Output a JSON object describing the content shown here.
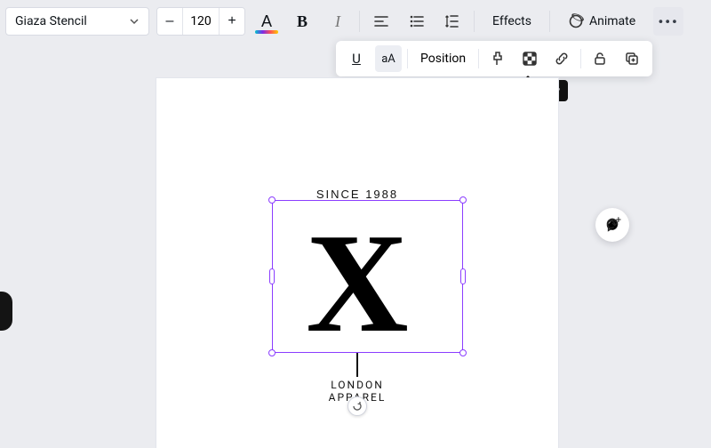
{
  "toolbar": {
    "font_name": "Giaza Stencil",
    "font_size": "120",
    "decrease": "–",
    "increase": "+",
    "color_label": "A",
    "bold": "B",
    "italic": "I",
    "effects": "Effects",
    "animate": "Animate",
    "more": "•••"
  },
  "popover": {
    "underline": "U",
    "case": "aA",
    "position": "Position",
    "tooltip": "Transparency"
  },
  "canvas": {
    "since": "SINCE 1988",
    "big_letter": "X",
    "city": "LONDON",
    "sub": "APPAREL"
  }
}
